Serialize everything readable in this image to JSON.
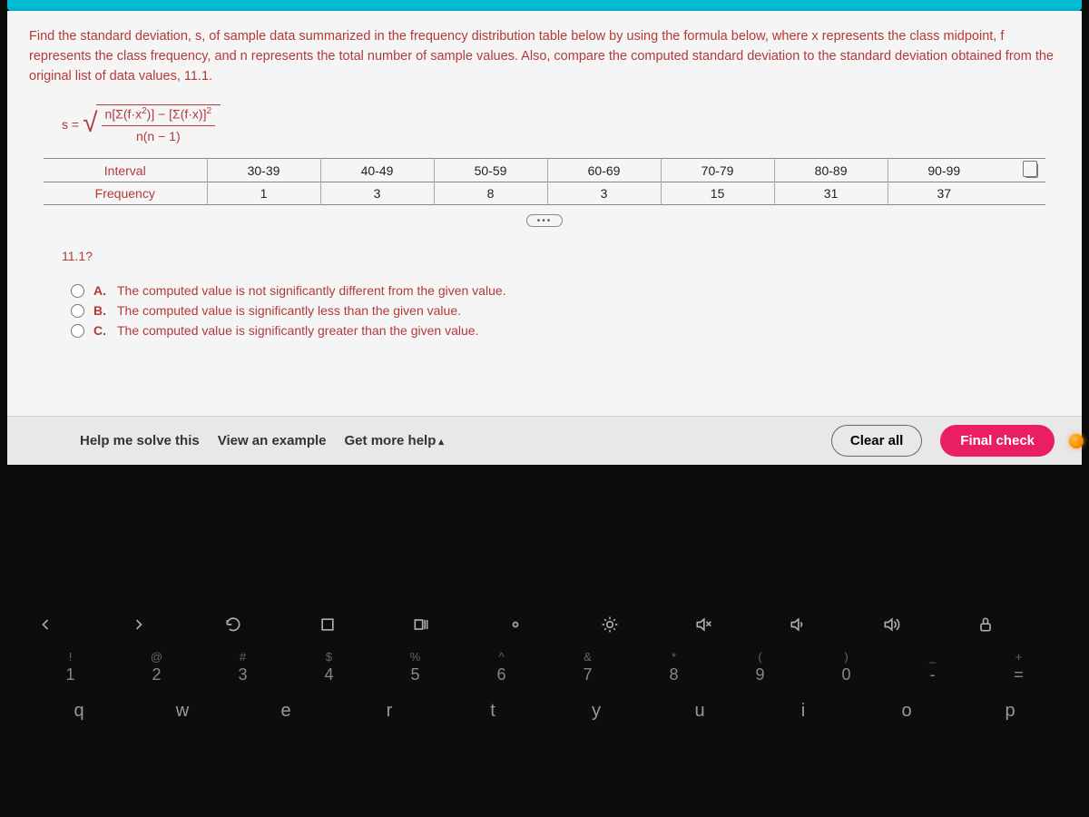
{
  "question": {
    "prompt": "Find the standard deviation, s, of sample data summarized in the frequency distribution table below by using the formula below, where x represents the class midpoint, f represents the class frequency, and n represents the total number of sample values. Also, compare the computed standard deviation to the standard deviation obtained from the original list of data values, 11.1.",
    "formula_lhs": "s =",
    "formula_num": "n[Σ(f·x²)] − [Σ(f·x)]²",
    "formula_den": "n(n − 1)",
    "table": {
      "row_labels": {
        "interval": "Interval",
        "frequency": "Frequency"
      },
      "intervals": [
        "30-39",
        "40-49",
        "50-59",
        "60-69",
        "70-79",
        "80-89",
        "90-99"
      ],
      "frequencies": [
        "1",
        "3",
        "8",
        "3",
        "15",
        "31",
        "37"
      ]
    },
    "sub_question": "11.1?",
    "choices": {
      "a": {
        "label": "A.",
        "text": "The computed value is not significantly different from the given value."
      },
      "b": {
        "label": "B.",
        "text": "The computed value is significantly less than the given value."
      },
      "c": {
        "label": "C.",
        "text": "The computed value is significantly greater than the given value."
      }
    }
  },
  "actions": {
    "help": "Help me solve this",
    "example": "View an example",
    "more_help": "Get more help",
    "clear": "Clear all",
    "final": "Final check"
  },
  "keyboard": {
    "num_upper": [
      "!",
      "@",
      "#",
      "$",
      "%",
      "^",
      "&",
      "*",
      "(",
      ")",
      "_",
      "+"
    ],
    "num_lower": [
      "1",
      "2",
      "3",
      "4",
      "5",
      "6",
      "7",
      "8",
      "9",
      "0",
      "-",
      "="
    ],
    "letters": [
      "q",
      "w",
      "e",
      "r",
      "t",
      "y",
      "u",
      "i",
      "o",
      "p"
    ]
  }
}
